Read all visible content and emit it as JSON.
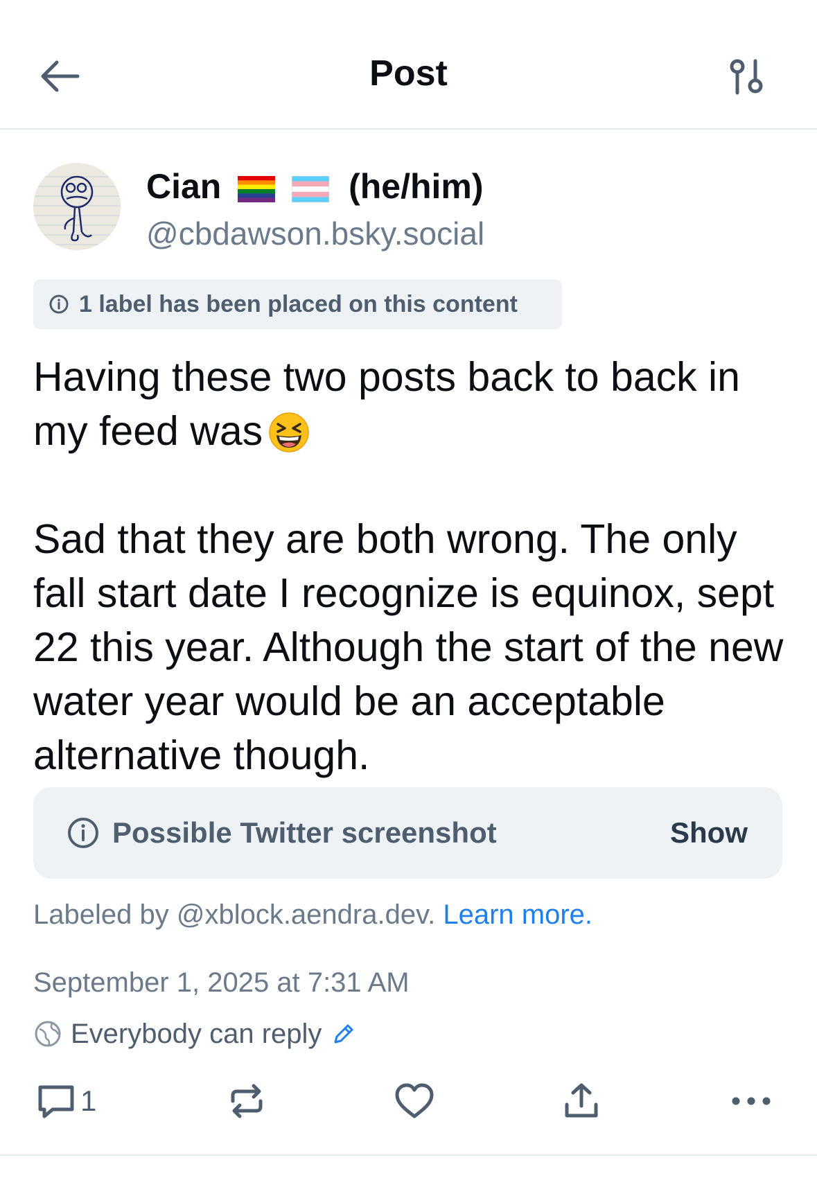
{
  "header": {
    "title": "Post",
    "back_icon": "arrow-left-icon",
    "settings_icon": "sliders-icon"
  },
  "author": {
    "name": "Cian",
    "flags": [
      "rainbow-flag-emoji",
      "transgender-flag-emoji"
    ],
    "pronouns": "(he/him)",
    "handle": "@cbdawson.bsky.social"
  },
  "label_notice": {
    "text": "1 label has been placed on this content",
    "icon": "info-circle-icon"
  },
  "post": {
    "line_1": "Having these two posts back to back in my feed was",
    "emoji": "grinning-squinting-face-emoji",
    "line_2": "Sad that they are both wrong. The only fall start date I recognize is equinox, sept 22 this year. Although the start of the new water year would be an acceptable alternative though."
  },
  "content_warning": {
    "label": "Possible Twitter screenshot",
    "show_label": "Show"
  },
  "labeled_by": {
    "prefix": "Labeled by @xblock.aendra.dev.",
    "link": "Learn more."
  },
  "timestamp": "September 1, 2025 at 7:31 AM",
  "reply_setting": {
    "text": "Everybody can reply"
  },
  "actions": {
    "reply_count": "1"
  },
  "colors": {
    "text_primary": "#0b0f14",
    "text_secondary": "#6b7a8a",
    "icon_gray": "#4f5e6e",
    "link_blue": "#1d80f0",
    "pill_bg": "#eef2f5",
    "divider": "#e6ebef"
  }
}
